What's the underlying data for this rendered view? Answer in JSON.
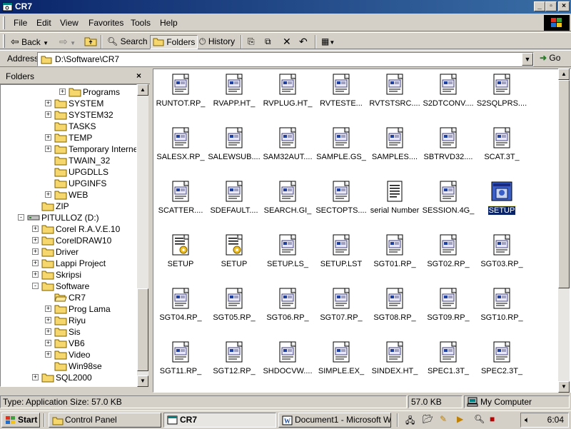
{
  "window": {
    "title": "CR7"
  },
  "menu": [
    "File",
    "Edit",
    "View",
    "Favorites",
    "Tools",
    "Help"
  ],
  "toolbar": {
    "back": "Back",
    "search": "Search",
    "folders": "Folders",
    "history": "History"
  },
  "address": {
    "label": "Address",
    "value": "D:\\Software\\CR7",
    "go": "Go"
  },
  "folders_pane": {
    "title": "Folders",
    "close": "×",
    "tree": [
      {
        "label": "Programs",
        "expand": "+",
        "depth": 3
      },
      {
        "label": "SYSTEM",
        "expand": "+",
        "depth": 2
      },
      {
        "label": "SYSTEM32",
        "expand": "+",
        "depth": 2
      },
      {
        "label": "TASKS",
        "expand": "",
        "depth": 2
      },
      {
        "label": "TEMP",
        "expand": "+",
        "depth": 2
      },
      {
        "label": "Temporary Internet",
        "expand": "+",
        "depth": 2
      },
      {
        "label": "TWAIN_32",
        "expand": "",
        "depth": 2
      },
      {
        "label": "UPGDLLS",
        "expand": "",
        "depth": 2
      },
      {
        "label": "UPGINFS",
        "expand": "",
        "depth": 2
      },
      {
        "label": "WEB",
        "expand": "+",
        "depth": 2
      },
      {
        "label": "ZIP",
        "expand": "",
        "depth": 1
      },
      {
        "label": "PITULLOZ (D:)",
        "expand": "-",
        "depth": 0,
        "drive": true
      },
      {
        "label": "Corel R.A.V.E.10",
        "expand": "+",
        "depth": 1
      },
      {
        "label": "CorelDRAW10",
        "expand": "+",
        "depth": 1
      },
      {
        "label": "Driver",
        "expand": "+",
        "depth": 1
      },
      {
        "label": "Lappi Project",
        "expand": "+",
        "depth": 1
      },
      {
        "label": "Skripsi",
        "expand": "+",
        "depth": 1
      },
      {
        "label": "Software",
        "expand": "-",
        "depth": 1
      },
      {
        "label": "CR7",
        "expand": "",
        "depth": 2,
        "open": true
      },
      {
        "label": "Prog Lama",
        "expand": "+",
        "depth": 2
      },
      {
        "label": "Riyu",
        "expand": "+",
        "depth": 2
      },
      {
        "label": "Sis",
        "expand": "+",
        "depth": 2
      },
      {
        "label": "VB6",
        "expand": "+",
        "depth": 2
      },
      {
        "label": "Video",
        "expand": "+",
        "depth": 2
      },
      {
        "label": "Win98se",
        "expand": "",
        "depth": 2
      },
      {
        "label": "SQL2000",
        "expand": "+",
        "depth": 1
      }
    ]
  },
  "files": [
    {
      "name": "RUNTOT.RP_",
      "kind": "compressed"
    },
    {
      "name": "RVAPP.HT_",
      "kind": "compressed"
    },
    {
      "name": "RVPLUG.HT_",
      "kind": "compressed"
    },
    {
      "name": "RVTESTE...",
      "kind": "compressed"
    },
    {
      "name": "RVTSTSRC....",
      "kind": "compressed"
    },
    {
      "name": "S2DTCONV....",
      "kind": "compressed"
    },
    {
      "name": "S2SQLPRS....",
      "kind": "compressed"
    },
    {
      "name": "SALESX.RP_",
      "kind": "compressed"
    },
    {
      "name": "SALEWSUB....",
      "kind": "compressed"
    },
    {
      "name": "SAM32AUT....",
      "kind": "compressed"
    },
    {
      "name": "SAMPLE.GS_",
      "kind": "compressed"
    },
    {
      "name": "SAMPLES....",
      "kind": "compressed"
    },
    {
      "name": "SBTRVD32....",
      "kind": "compressed"
    },
    {
      "name": "SCAT.3T_",
      "kind": "compressed"
    },
    {
      "name": "SCATTER....",
      "kind": "compressed"
    },
    {
      "name": "SDEFAULT....",
      "kind": "compressed"
    },
    {
      "name": "SEARCH.GI_",
      "kind": "compressed"
    },
    {
      "name": "SECTOPTS....",
      "kind": "compressed"
    },
    {
      "name": "serial Number",
      "kind": "text"
    },
    {
      "name": "SESSION.4G_",
      "kind": "compressed"
    },
    {
      "name": "SETUP",
      "kind": "app",
      "selected": true
    },
    {
      "name": "SETUP",
      "kind": "settings"
    },
    {
      "name": "SETUP",
      "kind": "settings"
    },
    {
      "name": "SETUP.LS_",
      "kind": "compressed"
    },
    {
      "name": "SETUP.LST",
      "kind": "compressed"
    },
    {
      "name": "SGT01.RP_",
      "kind": "compressed"
    },
    {
      "name": "SGT02.RP_",
      "kind": "compressed"
    },
    {
      "name": "SGT03.RP_",
      "kind": "compressed"
    },
    {
      "name": "SGT04.RP_",
      "kind": "compressed"
    },
    {
      "name": "SGT05.RP_",
      "kind": "compressed"
    },
    {
      "name": "SGT06.RP_",
      "kind": "compressed"
    },
    {
      "name": "SGT07.RP_",
      "kind": "compressed"
    },
    {
      "name": "SGT08.RP_",
      "kind": "compressed"
    },
    {
      "name": "SGT09.RP_",
      "kind": "compressed"
    },
    {
      "name": "SGT10.RP_",
      "kind": "compressed"
    },
    {
      "name": "SGT11.RP_",
      "kind": "compressed"
    },
    {
      "name": "SGT12.RP_",
      "kind": "compressed"
    },
    {
      "name": "SHDOCVW....",
      "kind": "compressed"
    },
    {
      "name": "SIMPLE.EX_",
      "kind": "compressed"
    },
    {
      "name": "SINDEX.HT_",
      "kind": "compressed"
    },
    {
      "name": "SPEC1.3T_",
      "kind": "compressed"
    },
    {
      "name": "SPEC2.3T_",
      "kind": "compressed"
    }
  ],
  "status": {
    "type": "Type: Application Size: 57.0 KB",
    "size": "57.0 KB",
    "zone": "My Computer"
  },
  "taskbar": {
    "start": "Start",
    "tasks": [
      "Control Panel",
      "CR7",
      "Document1 - Microsoft W..."
    ],
    "clock": "6:04"
  },
  "colors": {
    "titlebar": "#0a246a",
    "selection": "#0a246a",
    "face": "#d4d0c8"
  }
}
